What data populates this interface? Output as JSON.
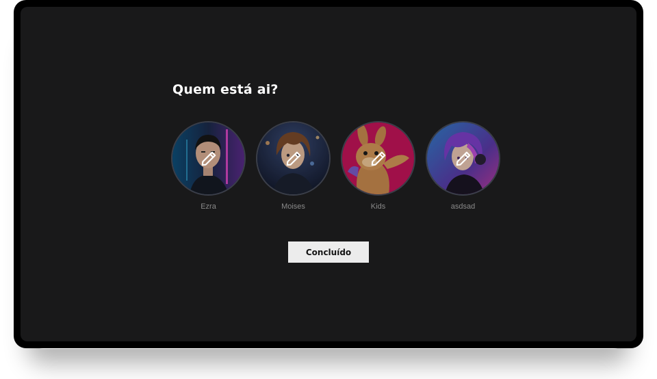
{
  "page": {
    "title": "Quem está ai?"
  },
  "profiles": [
    {
      "name": "Ezra",
      "edit_icon": "pencil-icon"
    },
    {
      "name": "Moises",
      "edit_icon": "pencil-icon"
    },
    {
      "name": "Kids",
      "edit_icon": "pencil-icon"
    },
    {
      "name": "asdsad",
      "edit_icon": "pencil-icon"
    }
  ],
  "actions": {
    "done_label": "Concluído"
  },
  "colors": {
    "background": "#19191a",
    "frame": "#000000",
    "title": "#ffffff",
    "profile_name": "#8a8a8a",
    "avatar_border": "#3b3f4a",
    "button_bg": "#ececec",
    "button_text": "#141414"
  }
}
